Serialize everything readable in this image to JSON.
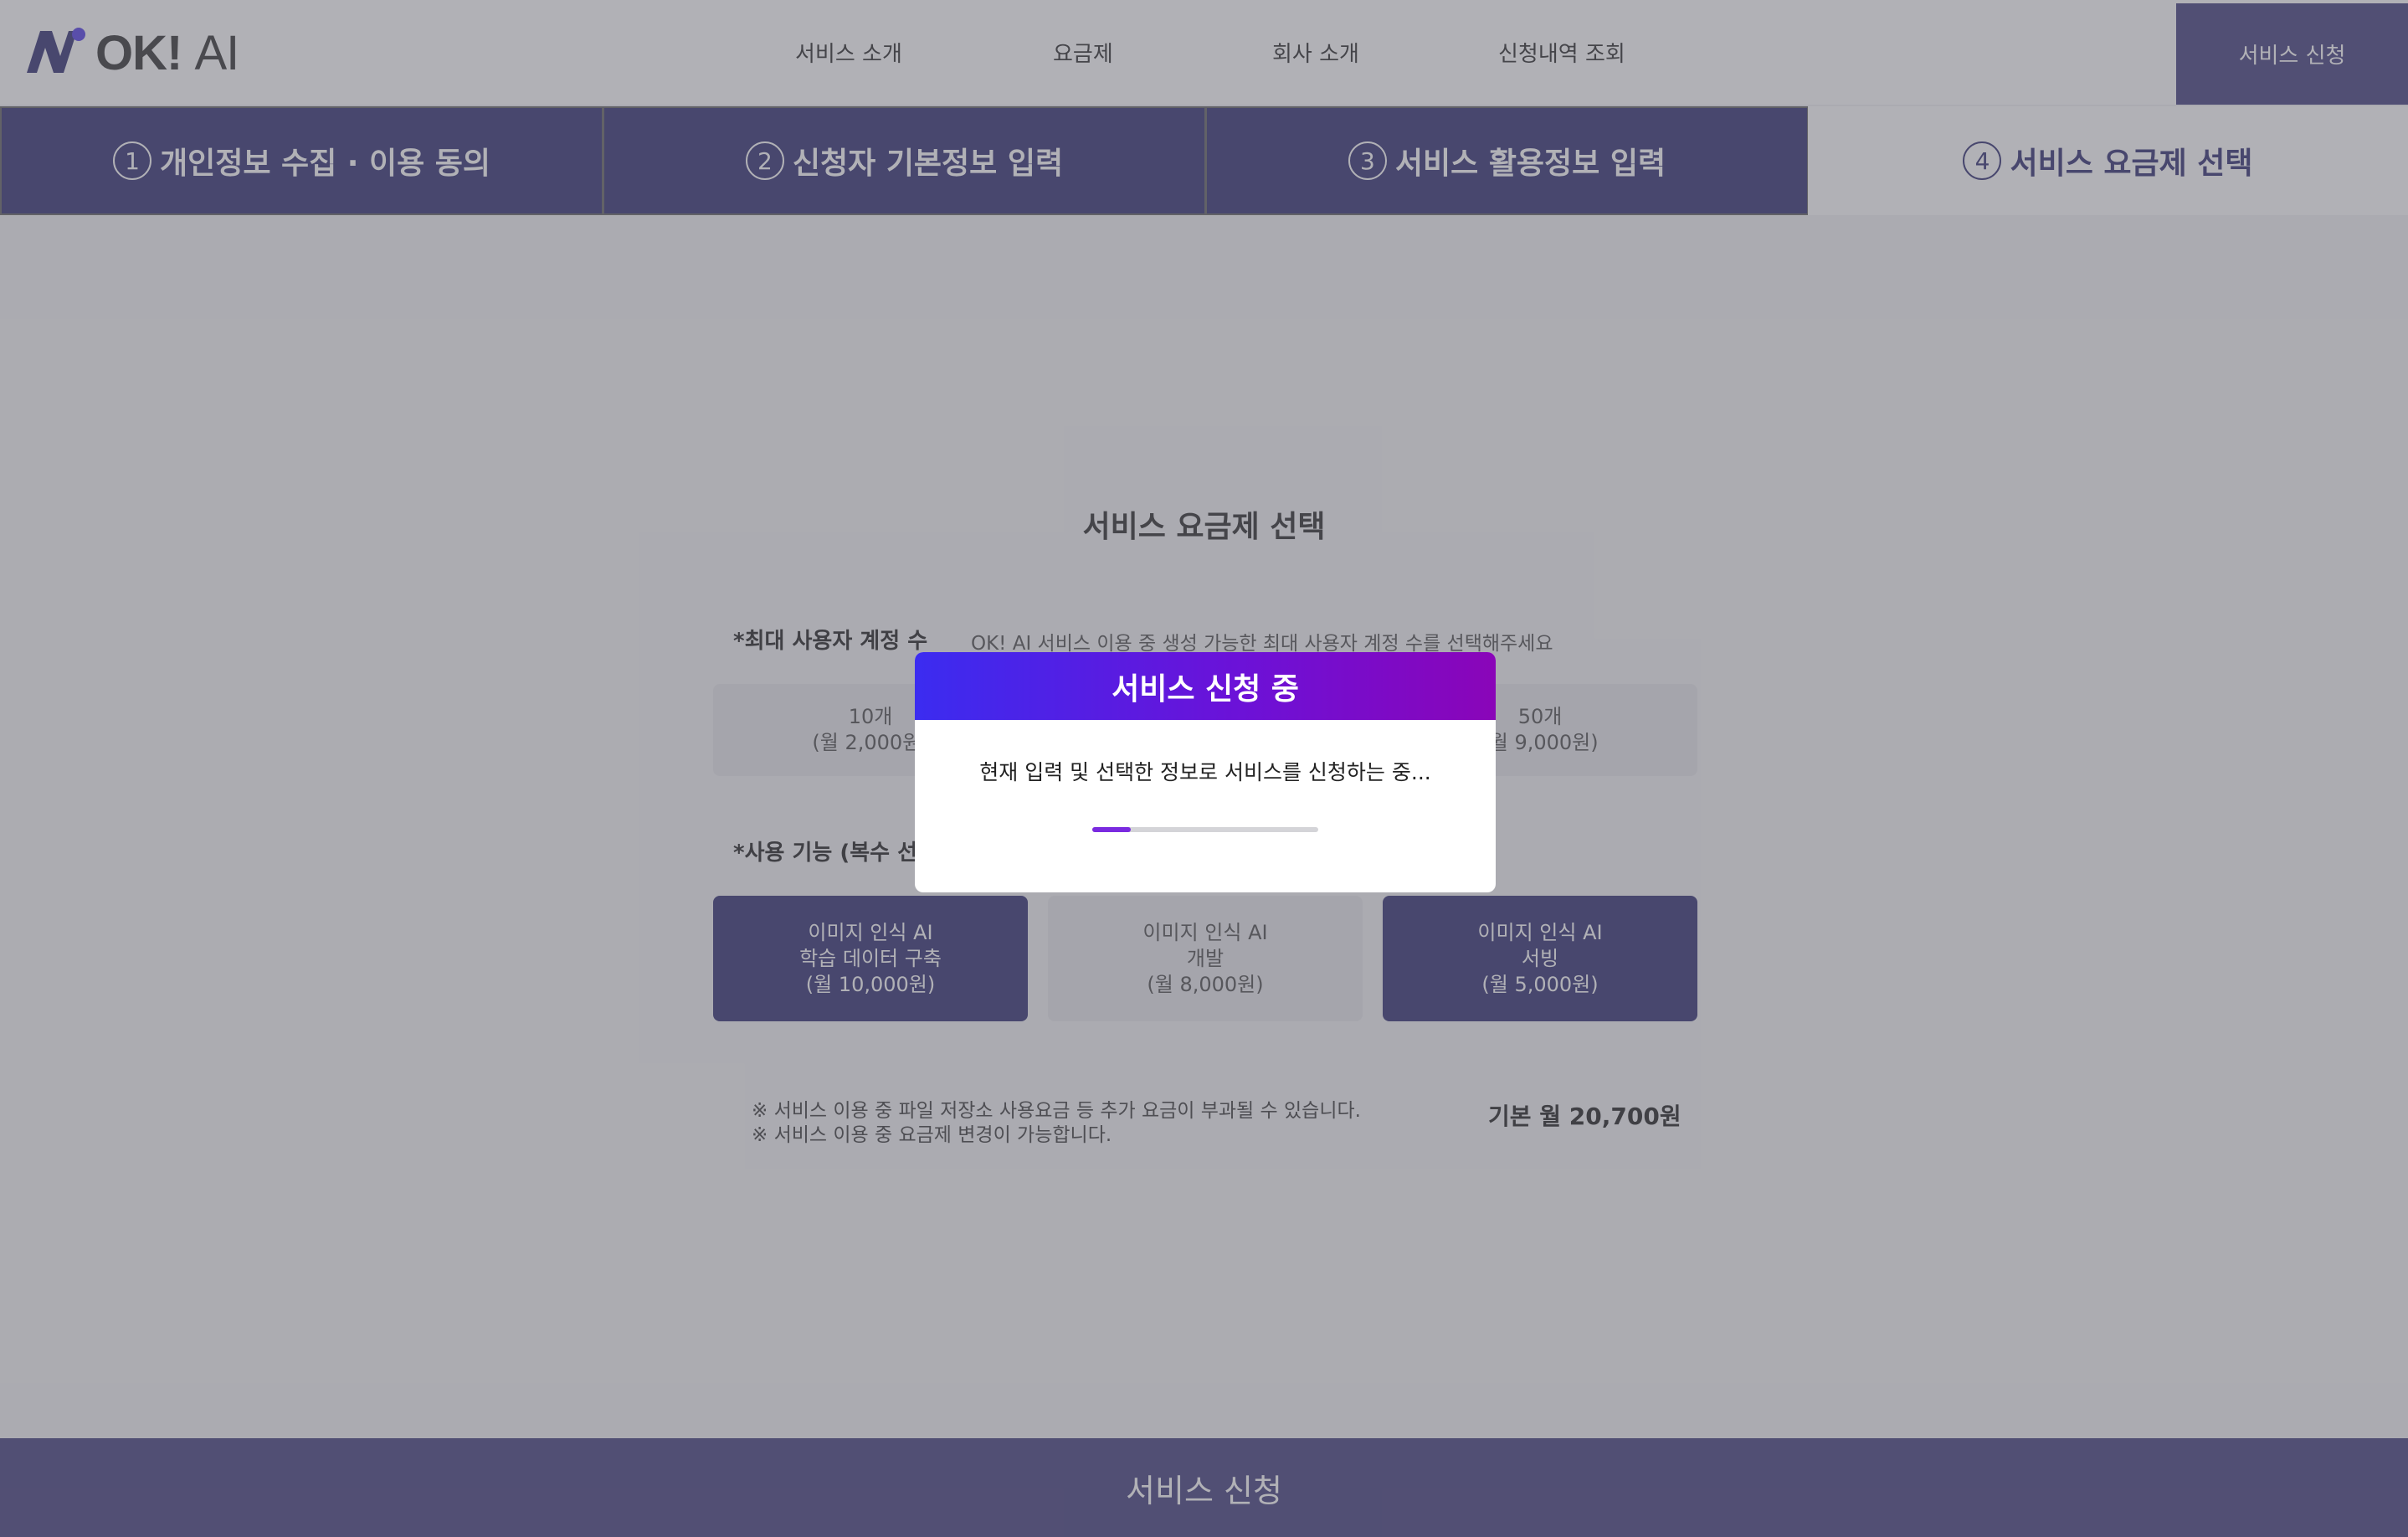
{
  "colors": {
    "accent": "#3a3878",
    "cta": "#4b4683",
    "modal_gradient_start": "#3b2cf0",
    "modal_gradient_end": "#8a05b8",
    "progress": "#7a2ae0"
  },
  "header": {
    "logo_icon": "ni-logo-icon",
    "logo_text": "OK!",
    "logo_ai": "AI",
    "nav": [
      "서비스 소개",
      "요금제",
      "회사 소개",
      "신청내역 조회"
    ],
    "cta_label": "서비스 신청"
  },
  "steps": [
    {
      "num": "1",
      "label": "개인정보 수집 · 이용 동의",
      "active": false
    },
    {
      "num": "2",
      "label": "신청자 기본정보 입력",
      "active": false
    },
    {
      "num": "3",
      "label": "서비스 활용정보 입력",
      "active": false
    },
    {
      "num": "4",
      "label": "서비스 요금제 선택",
      "active": true
    }
  ],
  "main": {
    "title": "서비스 요금제 선택",
    "accounts": {
      "label": "*최대 사용자 계정 수",
      "hint": "OK! AI 서비스 이용 중 생성 가능한 최대 사용자 계정 수를 선택해주세요",
      "options": [
        {
          "line1": "10개",
          "line2": "(월 2,000원)"
        },
        {
          "line1": "50개",
          "line2": "(월 9,000원)"
        }
      ]
    },
    "features": {
      "label": "*사용 기능 (복수 선택 가능)",
      "options": [
        {
          "line1": "이미지 인식 AI",
          "line2": "학습 데이터 구축",
          "line3": "(월 10,000원)",
          "selected": true
        },
        {
          "line1": "이미지 인식 AI",
          "line2": "개발",
          "line3": "(월 8,000원)",
          "selected": false
        },
        {
          "line1": "이미지 인식 AI",
          "line2": "서빙",
          "line3": "(월 5,000원)",
          "selected": true
        }
      ]
    },
    "notes": [
      "※ 서비스 이용 중 파일 저장소 사용요금 등 추가 요금이 부과될 수 있습니다.",
      "※ 서비스 이용 중 요금제 변경이 가능합니다."
    ],
    "total": "기본 월 20,700원"
  },
  "footer": {
    "submit_label": "서비스 신청"
  },
  "modal": {
    "title": "서비스 신청 중",
    "message": "현재 입력 및 선택한 정보로 서비스를 신청하는 중...",
    "progress_fraction": 0.17
  }
}
